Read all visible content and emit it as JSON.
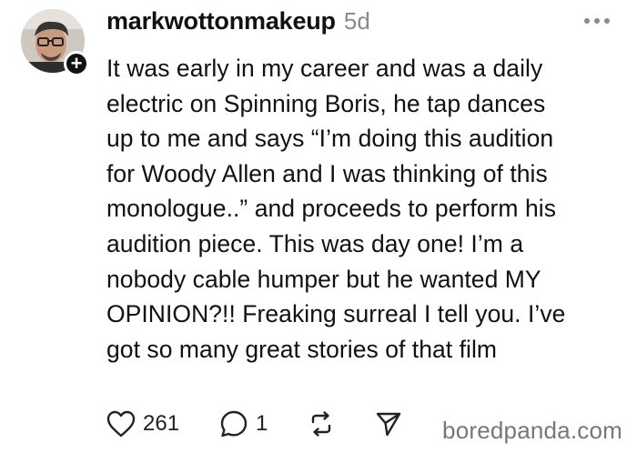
{
  "post": {
    "username": "markwottonmakeup",
    "timestamp": "5d",
    "body": "It was early in my career and was a daily\nelectric on Spinning Boris, he tap dances\nup to me and says “I’m doing this audition\nfor Woody Allen and I was thinking of this\nmonologue..” and proceeds to perform his\naudition piece. This was day one! I’m a\nnobody cable humper but he wanted MY\nOPINION?!! Freaking surreal I tell you. I’ve\ngot so many great stories of that film",
    "likes": "261",
    "replies": "1",
    "follow_badge": "+"
  },
  "icons": {
    "more": "more-options-icon",
    "like": "heart-icon",
    "reply": "comment-icon",
    "repost": "repost-icon",
    "share": "send-icon"
  },
  "watermark": "boredpanda.com",
  "colors": {
    "text": "#111111",
    "muted": "#8a8a8a",
    "badge": "#111111"
  }
}
